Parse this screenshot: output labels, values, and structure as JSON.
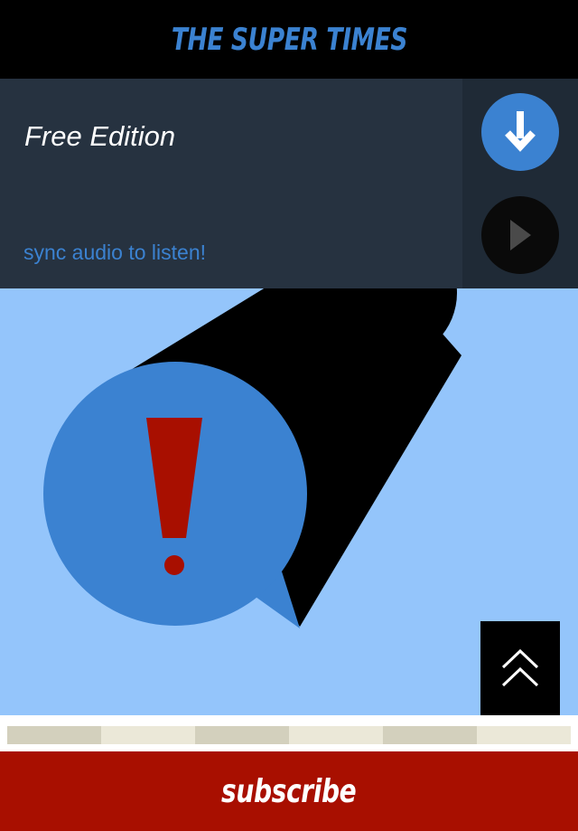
{
  "header": {
    "masthead": "THE SUPER TIMES"
  },
  "edition": {
    "title": "Free Edition",
    "status": "sync audio to listen!",
    "download_icon": "arrow-down-icon",
    "play_icon": "play-icon"
  },
  "cover": {
    "illustration": "megaphone-with-alert-speech-bubble",
    "alert_icon": "exclamation-icon",
    "scroll_top_icon": "double-chevron-up-icon"
  },
  "pagination": {
    "segments": 6
  },
  "subscribe": {
    "label": "subscribe"
  },
  "colors": {
    "masthead_blue": "#3b82d1",
    "panel_dark": "#263240",
    "cover_sky": "#94c5fb",
    "alert_red": "#a80f00",
    "subscribe_red": "#a80f00"
  }
}
